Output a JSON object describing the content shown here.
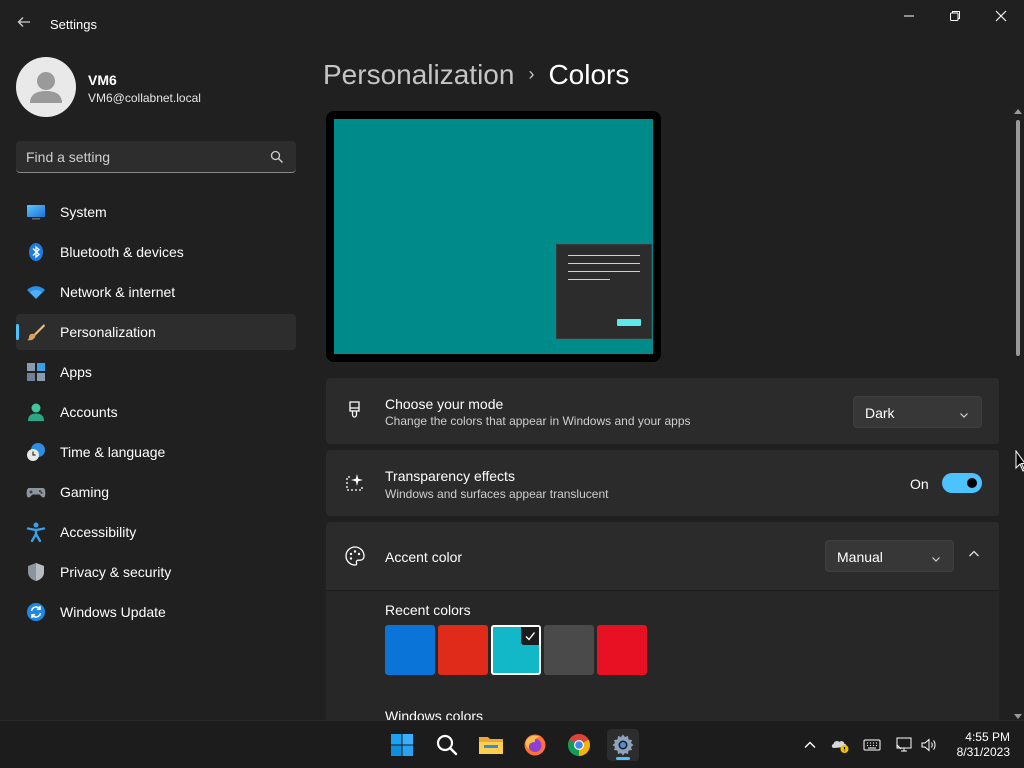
{
  "window": {
    "title": "Settings"
  },
  "profile": {
    "name": "VM6",
    "email": "VM6@collabnet.local"
  },
  "search": {
    "placeholder": "Find a setting"
  },
  "sidebar": {
    "items": [
      {
        "label": "System",
        "icon": "system-icon"
      },
      {
        "label": "Bluetooth & devices",
        "icon": "bluetooth-icon"
      },
      {
        "label": "Network & internet",
        "icon": "wifi-icon"
      },
      {
        "label": "Personalization",
        "icon": "brush-icon",
        "active": true
      },
      {
        "label": "Apps",
        "icon": "apps-icon"
      },
      {
        "label": "Accounts",
        "icon": "person-icon"
      },
      {
        "label": "Time & language",
        "icon": "clock-globe-icon"
      },
      {
        "label": "Gaming",
        "icon": "gamepad-icon"
      },
      {
        "label": "Accessibility",
        "icon": "accessibility-icon"
      },
      {
        "label": "Privacy & security",
        "icon": "shield-icon"
      },
      {
        "label": "Windows Update",
        "icon": "update-icon"
      }
    ]
  },
  "breadcrumb": {
    "parent": "Personalization",
    "separator": "›",
    "current": "Colors"
  },
  "settings": {
    "mode": {
      "title": "Choose your mode",
      "description": "Change the colors that appear in Windows and your apps",
      "value": "Dark"
    },
    "transparency": {
      "title": "Transparency effects",
      "description": "Windows and surfaces appear translucent",
      "state_label": "On",
      "on": true
    },
    "accent": {
      "title": "Accent color",
      "value": "Manual",
      "recent_label": "Recent colors",
      "recent_colors": [
        "#0b74d9",
        "#e02a1a",
        "#12b8c8",
        "#4a4a4a",
        "#e81123"
      ],
      "selected_index": 2,
      "windows_colors_label": "Windows colors"
    }
  },
  "taskbar": {
    "apps": [
      "start-icon",
      "search-icon",
      "file-explorer-icon",
      "firefox-icon",
      "chrome-icon",
      "settings-icon"
    ],
    "time": "4:55 PM",
    "date": "8/31/2023"
  },
  "colors": {
    "accent": "#4cc2ff",
    "preview_background": "#008b8b"
  }
}
